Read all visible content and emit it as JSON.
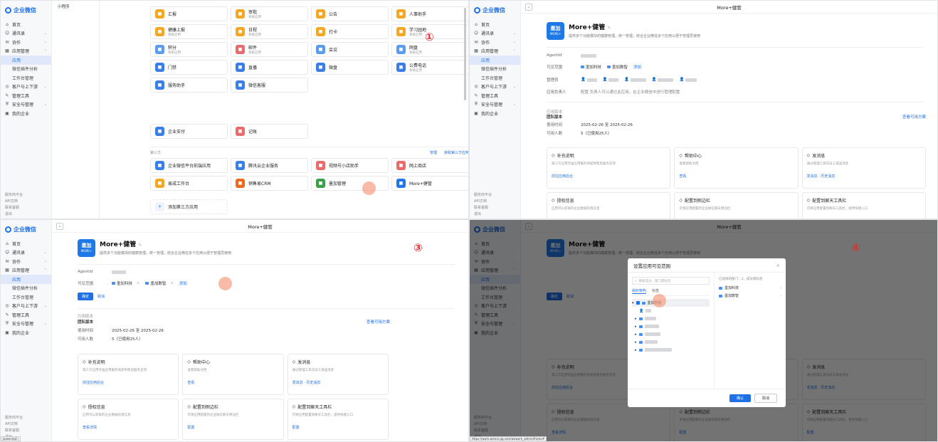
{
  "sidebar": {
    "logo": "企业微信",
    "items": [
      {
        "label": "首页",
        "icon": "home-icon"
      },
      {
        "label": "通讯录",
        "icon": "contacts-icon"
      },
      {
        "label": "协作",
        "icon": "collab-icon"
      },
      {
        "label": "应用管理",
        "icon": "apps-icon"
      },
      {
        "label": "应用",
        "icon": ""
      },
      {
        "label": "微信插件分析",
        "icon": ""
      },
      {
        "label": "工作台管理",
        "icon": ""
      },
      {
        "label": "客户与上下游",
        "icon": "customer-icon"
      },
      {
        "label": "管理工具",
        "icon": "tools-icon"
      },
      {
        "label": "安全与管理",
        "icon": "security-icon"
      },
      {
        "label": "我的企业",
        "icon": "company-icon"
      }
    ],
    "bottom": [
      "服务商平台",
      "API文档",
      "联系客服",
      "退出"
    ]
  },
  "panel1": {
    "label": "小程序",
    "tiles": [
      {
        "name": "汇报",
        "sub": "",
        "color": "#f5a623"
      },
      {
        "name": "审批",
        "sub": "系统应用",
        "color": "#f5a623"
      },
      {
        "name": "公告",
        "sub": "",
        "color": "#f5a623"
      },
      {
        "name": "人事助手",
        "sub": "",
        "color": "#f5a623"
      },
      {
        "name": "健康上报",
        "sub": "系统应用",
        "color": "#f5a623"
      },
      {
        "name": "日程",
        "sub": "系统应用",
        "color": "#f5a623"
      },
      {
        "name": "打卡",
        "sub": "",
        "color": "#f5a623"
      },
      {
        "name": "学习园地",
        "sub": "系统应用",
        "color": "#f5a623"
      },
      {
        "name": "积分",
        "sub": "系统应用",
        "color": "#5b9bf0"
      },
      {
        "name": "邮件",
        "sub": "系统应用",
        "color": "#e96b6b"
      },
      {
        "name": "会议",
        "sub": "",
        "color": "#5b9bf0"
      },
      {
        "name": "网盘",
        "sub": "系统应用",
        "color": "#5b9bf0"
      },
      {
        "name": "门禁",
        "sub": "",
        "color": "#3a7ee8"
      },
      {
        "name": "直播",
        "sub": "",
        "color": "#3a7ee8"
      },
      {
        "name": "微盘",
        "sub": "",
        "color": "#3a7ee8"
      },
      {
        "name": "公费电话",
        "sub": "系统应用",
        "color": "#3a7ee8"
      },
      {
        "name": "服务助手",
        "sub": "",
        "color": "#3a7ee8"
      },
      {
        "name": "微信客服",
        "sub": "",
        "color": "#3a7ee8"
      }
    ],
    "row2": [
      {
        "name": "企业支付",
        "sub": "",
        "color": "#3a7ee8"
      },
      {
        "name": "记账",
        "sub": "",
        "color": "#e96b6b"
      }
    ],
    "section_title": "第三方",
    "section_links": [
      "管理",
      "获取第三方应用"
    ],
    "third_party": [
      {
        "name": "企业微信平台前端应用",
        "color": "#3a7ee8"
      },
      {
        "name": "腾讯云企业服务",
        "color": "#3a7ee8"
      },
      {
        "name": "视频号小店助手",
        "color": "#e96b6b"
      },
      {
        "name": "网上商店",
        "color": "#e96b6b"
      },
      {
        "name": "易成工作台",
        "color": "#f5a623"
      },
      {
        "name": "销售易CRM",
        "color": "#f06a1e"
      },
      {
        "name": "墨加管理",
        "color": "#3aa04a"
      },
      {
        "name": "More+健管",
        "color": "#1f78e8"
      }
    ],
    "add_label": "添加第三方应用"
  },
  "detail": {
    "page_title": "More+健管",
    "app_icon_text": "墨加",
    "app_icon_sub": "MORE+",
    "app_name": "More+健管",
    "app_desc": "提供多个功能模块的健康管理，统一管理，结合企业微信多个应用以便于管理员使用",
    "agent_label": "AgentId",
    "visible_label": "可见范围",
    "visible_chips": [
      "墨加科技",
      "墨加数智"
    ],
    "visible_edit": "添加",
    "admin_label": "管理员",
    "owner_label": "应用负责人",
    "owner_text": "配置 负责人可以通过此应用，在企业微信中进行管理配置",
    "btn_ok": "确定",
    "btn_cancel": "取消",
    "status_title": "应用版本",
    "status_value": "团队版本",
    "status_link": "查看可用方案",
    "date_label": "使用时间",
    "date_value": "2025-02-26 至 2025-02-26",
    "users_label": "可用人数",
    "users_value": "5（已使用25人）",
    "cards": [
      {
        "title": "补充说明",
        "desc": "第三方应用可由应用服务商提供售后服务支持",
        "link": "前往应用后台"
      },
      {
        "title": "帮助中心",
        "desc": "查看帮助文档",
        "link": "查看"
      },
      {
        "title": "发消息",
        "desc": "通过管理工具向员工发送消息",
        "link": "发消息 · 历史消息"
      },
      {
        "title": "授权信息",
        "desc": "应用可以获取的企业数据权限信息",
        "link": "查看详情"
      },
      {
        "title": "配置到侧边栏",
        "desc": "可将应用配置到企业微信聊天侧边栏",
        "link": "配置"
      },
      {
        "title": "配置到聊天工具栏",
        "desc": "可将应用配置到聊天工具栏，提供快捷入口",
        "link": "配置"
      }
    ]
  },
  "dialog": {
    "title": "设置应用可见范围",
    "search_placeholder": "搜索成员、部门或标签",
    "tabs": [
      "组织架构",
      "标签"
    ],
    "tree_root": "墨加科技",
    "selected_header": "已选择的部门：2，成员和标签",
    "selected": [
      "墨加科技",
      "墨加数智"
    ],
    "ok": "确认",
    "cancel": "取消"
  },
  "status_url": "https://work.weixin.qq.com/wework_admin/frame#",
  "markers": [
    "①",
    "②",
    "③",
    "④"
  ]
}
